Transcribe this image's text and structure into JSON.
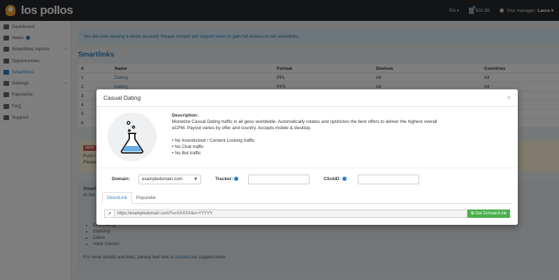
{
  "app": {
    "logo_text": "los pollos"
  },
  "topbar": {
    "language": "EN ▾",
    "balance": "$32.85",
    "manager_label": "Your manager:",
    "manager_name": "Laura ▾"
  },
  "sidebar": {
    "items": [
      {
        "label": "Dashboard",
        "icon": "dashboard-icon"
      },
      {
        "label": "News",
        "icon": "news-icon",
        "badge": true
      },
      {
        "label": "Smartlinks reports",
        "icon": "chart-icon",
        "arrow": "›"
      },
      {
        "label": "Opportunities",
        "icon": "star-icon"
      },
      {
        "label": "Smartlinks",
        "icon": "flask-icon",
        "active": true
      },
      {
        "label": "Settings",
        "icon": "gear-icon",
        "arrow": "›"
      },
      {
        "label": "Payments",
        "icon": "payments-icon"
      },
      {
        "label": "FAQ",
        "icon": "question-icon"
      },
      {
        "label": "Support",
        "icon": "envelope-icon"
      }
    ]
  },
  "alert": {
    "text_before": "You are now viewing a demo account. Please contact our ",
    "link": "support team",
    "text_after": " to gain full access to our smartlinks."
  },
  "page_title": "Smartlinks",
  "table": {
    "headers": [
      "#",
      "Name",
      "Format",
      "Devices",
      "Countries"
    ],
    "rows": [
      [
        "1",
        "Dating",
        "PPL",
        "All",
        "All"
      ],
      [
        "2",
        "Dating",
        "PPS",
        "All",
        "All"
      ],
      [
        "3",
        "",
        "",
        "",
        ""
      ],
      [
        "4",
        "",
        "",
        "",
        ""
      ],
      [
        "5",
        "",
        "",
        "",
        ""
      ],
      [
        "6",
        "",
        "",
        "",
        ""
      ]
    ]
  },
  "news": {
    "badge": "NEW",
    "line1": "Push n",
    "line2": "Please"
  },
  "info": {
    "title": "Smartl",
    "intro": "At the",
    "list": [
      "Gay Dating",
      "iGaming",
      "Cams",
      "Adult Games"
    ],
    "footer_before": "For more details and links, please feel free to ",
    "footer_link": "contact",
    "footer_after": " our support team."
  },
  "modal": {
    "title": "Casual Dating",
    "close": "×",
    "desc_label": "Description:",
    "desc_line1": "Monetize Casual Dating traffic in all geos worldwide. Automatically rotates and optimizes the best offers to deliver the highest overall",
    "desc_line2": "eCPM. Payout varies by offer and country. Accepts mobile & desktop.",
    "features": [
      "• No Incentivized / Content Locking traffic",
      "• No Chat traffic",
      "• No Bot traffic"
    ],
    "domain_label": "Domain:",
    "domain_value": "exampledomain.com",
    "tracker_label": "Tracker:",
    "clickid_label": "ClickID:",
    "tabs": [
      "DirectLink",
      "Popunder"
    ],
    "link_url": "https://exampledomain.com/?u=XXXXX&o=YYYYY",
    "get_button": "Get Domain/Link"
  }
}
